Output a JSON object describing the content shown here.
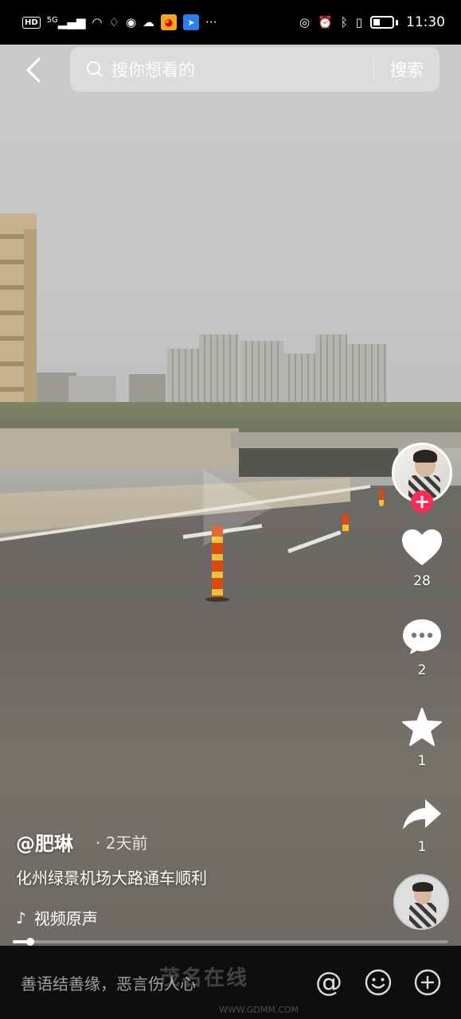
{
  "status_bar": {
    "left_badge": "HD",
    "network": "5G",
    "time": "11:30",
    "more": "···"
  },
  "top_bar": {
    "search_placeholder": "搜你想看的",
    "search_button": "搜索"
  },
  "video": {
    "author": "@肥琳",
    "posted": "· 2天前",
    "caption": "化州绿景机场大路通车顺利",
    "music": "视频原声",
    "progress": 0.04
  },
  "actions": {
    "likes": "28",
    "comments": "2",
    "favorites": "1",
    "shares": "1"
  },
  "comment_bar": {
    "placeholder": "善语结善缘，恶言伤人心"
  },
  "watermark": {
    "brand": "茂名在线",
    "url": "WWW.GDMM.COM"
  },
  "colors": {
    "follow_accent": "#fe2c55",
    "bar_bg": "#0e0e0e"
  }
}
